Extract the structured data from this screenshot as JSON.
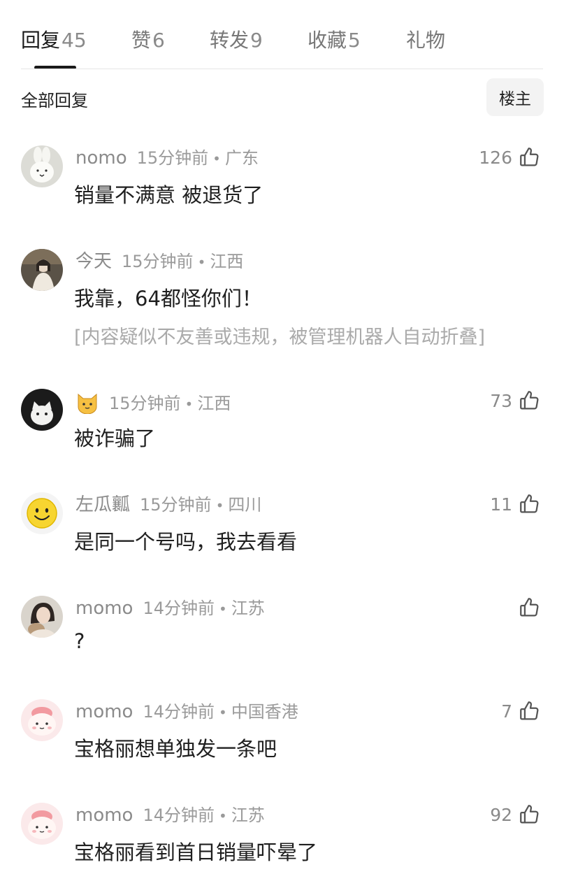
{
  "tabs": [
    {
      "label": "回复",
      "count": "45"
    },
    {
      "label": "赞",
      "count": "6"
    },
    {
      "label": "转发",
      "count": "9"
    },
    {
      "label": "收藏",
      "count": "5"
    },
    {
      "label": "礼物",
      "count": ""
    }
  ],
  "section": {
    "title": "全部回复",
    "op_button": "楼主"
  },
  "comments": [
    {
      "user": "nomo",
      "time": "15分钟前",
      "sep": "•",
      "location": "广东",
      "text": "销量不满意 被退货了",
      "likes": "126",
      "avatar": "bunny-plush-avatar"
    },
    {
      "user": "今天",
      "time": "15分钟前",
      "sep": "•",
      "location": "江西",
      "text": "我靠，64都怪你们！",
      "folded_note": "[内容疑似不友善或违规，被管理机器人自动折叠]",
      "likes": "",
      "avatar": "girl-photo-avatar"
    },
    {
      "user": "🐱",
      "time": "15分钟前",
      "sep": "•",
      "location": "江西",
      "text": "被诈骗了",
      "likes": "73",
      "avatar": "cat-photo-avatar"
    },
    {
      "user": "左瓜瓤",
      "time": "15分钟前",
      "sep": "•",
      "location": "四川",
      "text": "是同一个号吗，我去看看",
      "likes": "11",
      "avatar": "smiley-avatar"
    },
    {
      "user": "momo",
      "time": "14分钟前",
      "sep": "•",
      "location": "江苏",
      "text": "?",
      "likes": "",
      "avatar": "girl-cat-photo-avatar"
    },
    {
      "user": "momo",
      "time": "14分钟前",
      "sep": "•",
      "location": "中国香港",
      "text": "宝格丽想单独发一条吧",
      "likes": "7",
      "avatar": "pink-cartoon-avatar"
    },
    {
      "user": "momo",
      "time": "14分钟前",
      "sep": "•",
      "location": "江苏",
      "text": "宝格丽看到首日销量吓晕了",
      "likes": "92",
      "avatar": "pink-cartoon-avatar"
    }
  ]
}
